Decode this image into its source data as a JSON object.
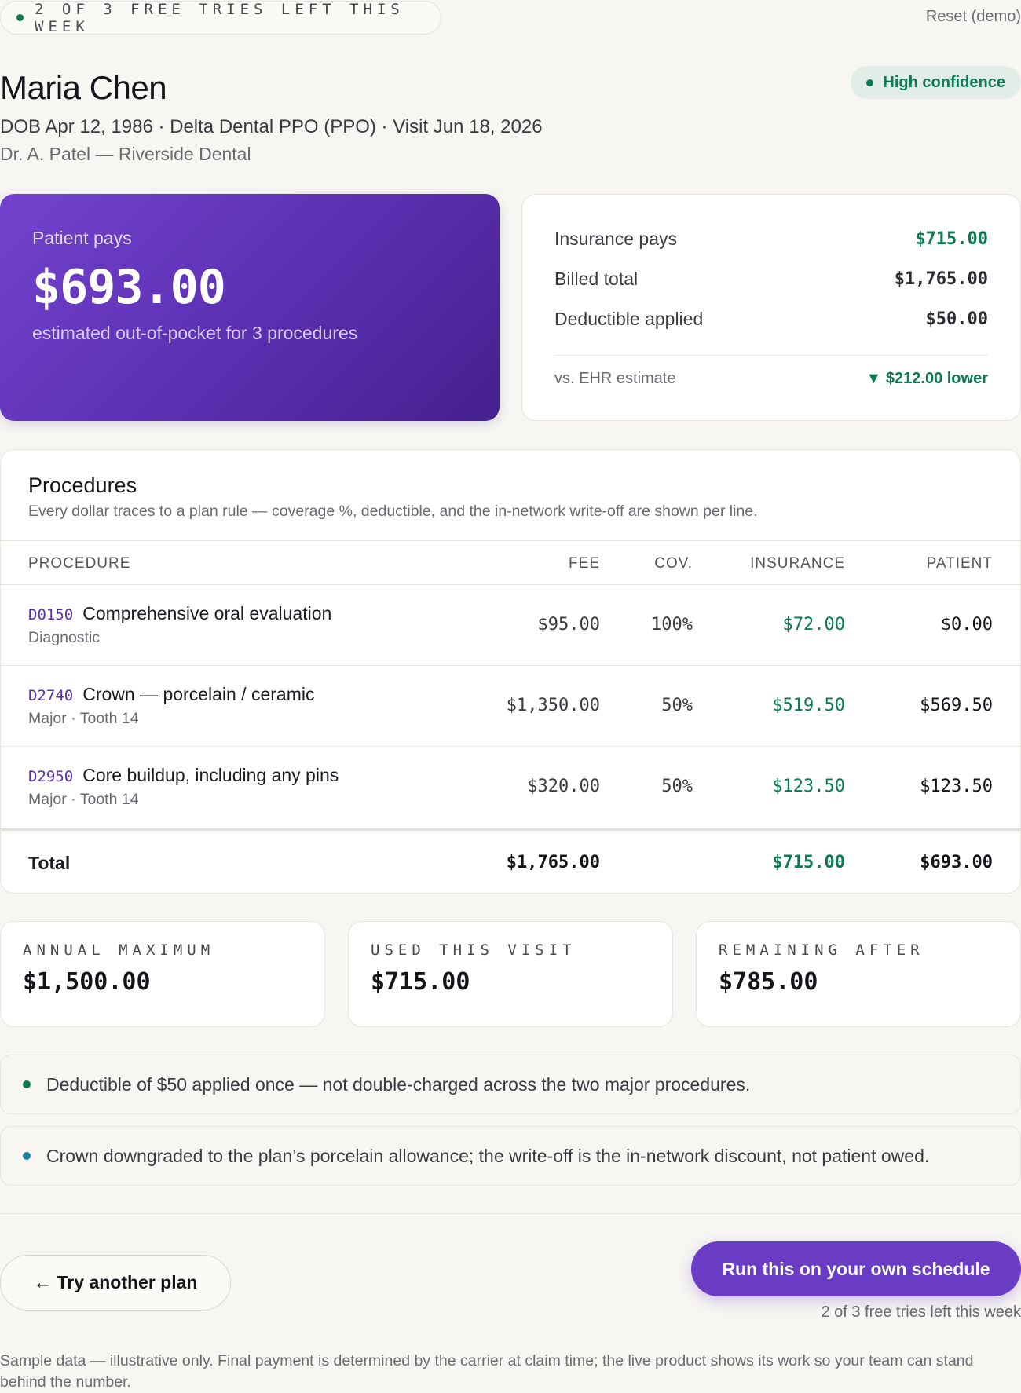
{
  "topbar": {
    "tries_text": "2 OF 3 FREE TRIES LEFT THIS WEEK",
    "reset_label": "Reset (demo)"
  },
  "patient": {
    "name": "Maria Chen",
    "meta_line": "DOB Apr 12, 1986 · Delta Dental PPO (PPO) · Visit Jun 18, 2026",
    "provider_line": "Dr. A. Patel — Riverside Dental",
    "confidence": "High confidence"
  },
  "summary": {
    "patient_pays_label": "Patient pays",
    "patient_pays_amount": "$693.00",
    "patient_pays_sub": "estimated out-of-pocket for 3 procedures",
    "rows": [
      {
        "label": "Insurance pays",
        "value": "$715.00"
      },
      {
        "label": "Billed total",
        "value": "$1,765.00"
      },
      {
        "label": "Deductible applied",
        "value": "$50.00"
      }
    ],
    "ehr_label": "vs. EHR estimate",
    "ehr_delta": "▼ $212.00 lower"
  },
  "procedures": {
    "title": "Procedures",
    "description": "Every dollar traces to a plan rule — coverage %, deductible, and the in-network write-off are shown per line.",
    "headers": {
      "procedure": "PROCEDURE",
      "fee": "FEE",
      "cov": "COV.",
      "insurance": "INSURANCE",
      "patient": "PATIENT"
    },
    "rows": [
      {
        "code": "D0150",
        "name": "Comprehensive oral evaluation",
        "detail": "Diagnostic",
        "fee": "$95.00",
        "cov": "100%",
        "insurance": "$72.00",
        "patient": "$0.00"
      },
      {
        "code": "D2740",
        "name": "Crown — porcelain / ceramic",
        "detail": "Major · Tooth 14",
        "fee": "$1,350.00",
        "cov": "50%",
        "insurance": "$519.50",
        "patient": "$569.50"
      },
      {
        "code": "D2950",
        "name": "Core buildup, including any pins",
        "detail": "Major · Tooth 14",
        "fee": "$320.00",
        "cov": "50%",
        "insurance": "$123.50",
        "patient": "$123.50"
      }
    ],
    "total": {
      "label": "Total",
      "fee": "$1,765.00",
      "insurance": "$715.00",
      "patient": "$693.00"
    }
  },
  "stats": [
    {
      "label": "ANNUAL MAXIMUM",
      "value": "$1,500.00"
    },
    {
      "label": "USED THIS VISIT",
      "value": "$715.00"
    },
    {
      "label": "REMAINING AFTER",
      "value": "$785.00"
    }
  ],
  "notes": [
    {
      "text": "Deductible of $50 applied once — not double-charged across the two major procedures.",
      "dot_color": "#0c7a52"
    },
    {
      "text": "Crown downgraded to the plan’s porcelain allowance; the write-off is the in-network discount, not patient owed.",
      "dot_color": "#1a7fa0"
    }
  ],
  "actions": {
    "try_another_label": "Try another plan",
    "run_label": "Run this on your own schedule",
    "run_sub": "2 of 3 free tries left this week"
  },
  "disclaimer": "Sample data — illustrative only. Final payment is determined by the carrier at claim time; the live product shows its work so your team can stand behind the number.",
  "colors": {
    "accent": "#6a3cc6",
    "positive": "#0c7a52",
    "background": "#f7f6f3"
  }
}
